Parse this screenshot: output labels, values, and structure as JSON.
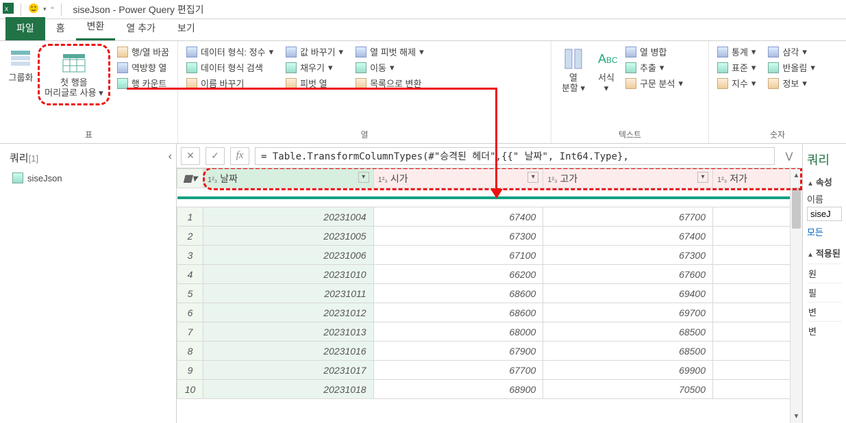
{
  "titlebar": {
    "title": "siseJson - Power Query 편집기"
  },
  "tabs": {
    "file": "파일",
    "home": "홈",
    "transform": "변환",
    "addcol": "열 추가",
    "view": "보기"
  },
  "ribbon": {
    "group_table": "표",
    "group_column": "열",
    "group_text": "텍스트",
    "group_number": "숫자",
    "groupby": "그룹화",
    "first_row_top": "첫 행을",
    "first_row_bot": "머리글로 사용",
    "swap": "행/열 바꿈",
    "reverse": "역방향 열",
    "rowcount": "행 카운트",
    "datatype": "데이터 형식: 정수",
    "detect": "데이터 형식 검색",
    "rename": "이름 바꾸기",
    "replace": "값 바꾸기",
    "fill": "채우기",
    "pivot": "피벗 열",
    "unpivot": "열 피벗 해제",
    "move": "이동",
    "tolist": "목록으로 변환",
    "split": "열",
    "split2": "분할",
    "format": "서식",
    "merge": "열 병합",
    "extract": "추출",
    "parse": "구문 분석",
    "stats": "통계",
    "std": "표준",
    "triangle": "삼각",
    "rounding": "반올림",
    "exponent": "지수",
    "info": "정보"
  },
  "qpane": {
    "title": "쿼리",
    "count": "[1]",
    "item1": "siseJson"
  },
  "fx": {
    "formula": "= Table.TransformColumnTypes(#\"승격된 헤더\",{{\" 날짜\", Int64.Type},"
  },
  "cols": {
    "c1": "날짜",
    "c2": "시가",
    "c3": "고가",
    "c4": "저가"
  },
  "rows": [
    {
      "n": "1",
      "a": "20231004",
      "b": "67400",
      "c": "67700"
    },
    {
      "n": "2",
      "a": "20231005",
      "b": "67300",
      "c": "67400"
    },
    {
      "n": "3",
      "a": "20231006",
      "b": "67100",
      "c": "67300"
    },
    {
      "n": "4",
      "a": "20231010",
      "b": "66200",
      "c": "67600"
    },
    {
      "n": "5",
      "a": "20231011",
      "b": "68600",
      "c": "69400"
    },
    {
      "n": "6",
      "a": "20231012",
      "b": "68600",
      "c": "69700"
    },
    {
      "n": "7",
      "a": "20231013",
      "b": "68000",
      "c": "68500"
    },
    {
      "n": "8",
      "a": "20231016",
      "b": "67900",
      "c": "68500"
    },
    {
      "n": "9",
      "a": "20231017",
      "b": "67700",
      "c": "69900"
    },
    {
      "n": "10",
      "a": "20231018",
      "b": "68900",
      "c": "70500"
    }
  ],
  "rpane": {
    "title": "쿼리",
    "props": "속성",
    "name": "이름",
    "nameval": "siseJ",
    "allprops": "모든",
    "applied": "적용된",
    "s1": "원",
    "s2": "필",
    "s3": "변",
    "s4": "변"
  }
}
